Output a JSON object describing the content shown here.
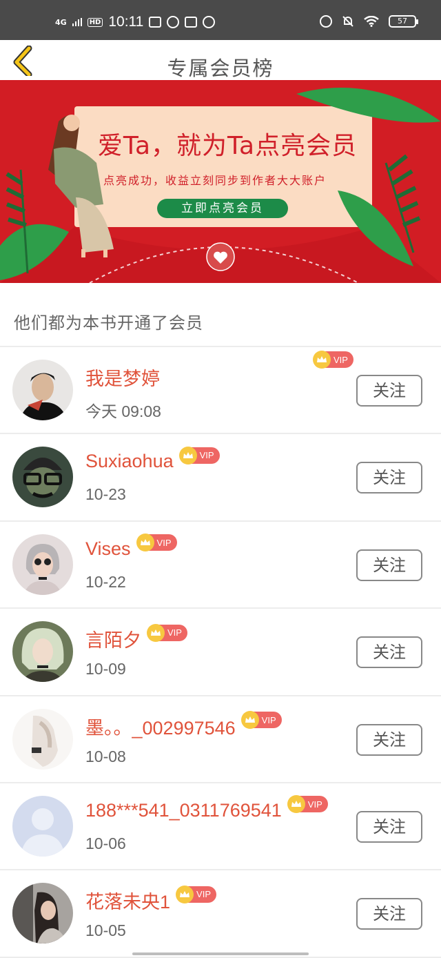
{
  "status_bar": {
    "network": "4G",
    "hd": "HD",
    "time": "10:11",
    "battery": "57"
  },
  "nav": {
    "title": "专属会员榜"
  },
  "banner": {
    "title": "爱Ta，就为Ta点亮会员",
    "subtitle": "点亮成功，收益立刻同步到作者大大账户",
    "button": "立即点亮会员",
    "colors": {
      "background": "#d21d24",
      "card": "#fbdcc3",
      "button": "#1c8b48"
    }
  },
  "section": {
    "title": "他们都为本书开通了会员"
  },
  "members": [
    {
      "name": "我是梦婷",
      "date": "今天 09:08",
      "vip": "VIP",
      "follow": "关注"
    },
    {
      "name": "Suxiaohua",
      "date": "10-23",
      "vip": "VIP",
      "follow": "关注"
    },
    {
      "name": "Vises",
      "date": "10-22",
      "vip": "VIP",
      "follow": "关注"
    },
    {
      "name": "言陌夕",
      "date": "10-09",
      "vip": "VIP",
      "follow": "关注"
    },
    {
      "name": "墨。。_002997546",
      "date": "10-08",
      "vip": "VIP",
      "follow": "关注"
    },
    {
      "name": "188***541_0311769541",
      "date": "10-06",
      "vip": "VIP",
      "follow": "关注"
    },
    {
      "name": "花落未央1",
      "date": "10-05",
      "vip": "VIP",
      "follow": "关注"
    }
  ],
  "colors": {
    "name": "#e0533b",
    "vip_badge": "#ee6663",
    "crown": "#f7c840"
  }
}
